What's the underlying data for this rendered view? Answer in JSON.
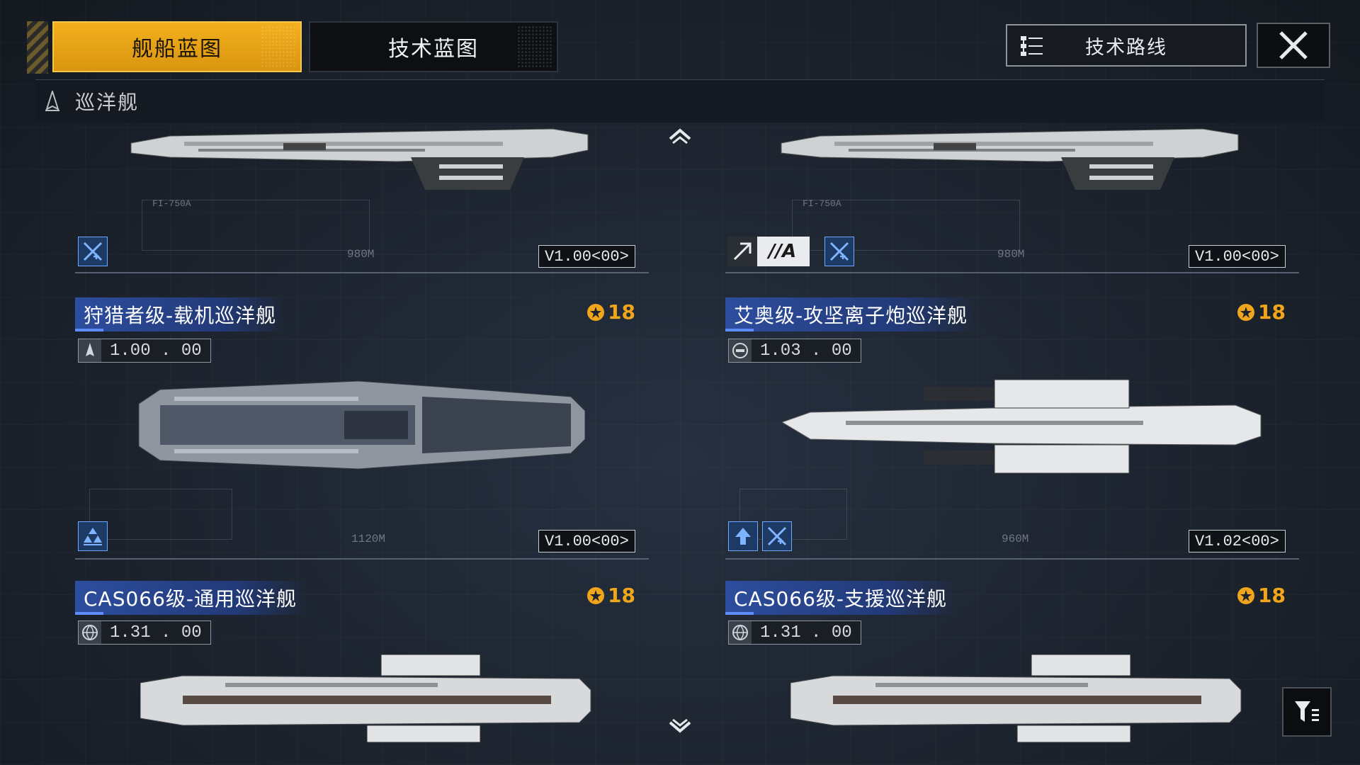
{
  "tabs": {
    "ship_blueprint": "舰船蓝图",
    "tech_blueprint": "技术蓝图"
  },
  "top_right": {
    "tech_route": "技术路线"
  },
  "category": {
    "title": "巡洋舰"
  },
  "top_cards": [
    {
      "version_tag": "V1.00<00>",
      "length": "980M",
      "weapon_code": "FI-750A"
    },
    {
      "version_tag": "V1.00<00>",
      "length": "980M",
      "weapon_code": "FI-750A",
      "badge_text": "//A"
    }
  ],
  "cards": [
    {
      "name": "狩猎者级-载机巡洋舰",
      "level": "18",
      "stat": "1.00",
      "stat_sub": "00",
      "version_tag": "V1.00<00>",
      "length": "1120M"
    },
    {
      "name": "艾奥级-攻坚离子炮巡洋舰",
      "level": "18",
      "stat": "1.03",
      "stat_sub": "00",
      "version_tag": "V1.02<00>",
      "length": "960M"
    },
    {
      "name": "CAS066级-通用巡洋舰",
      "level": "18",
      "stat": "1.31",
      "stat_sub": "00"
    },
    {
      "name": "CAS066级-支援巡洋舰",
      "level": "18",
      "stat": "1.31",
      "stat_sub": "00"
    }
  ],
  "colors": {
    "accent": "#f0a51a",
    "name_strip": "#2d4d9e",
    "badge_blue": "#6fa8ff"
  }
}
